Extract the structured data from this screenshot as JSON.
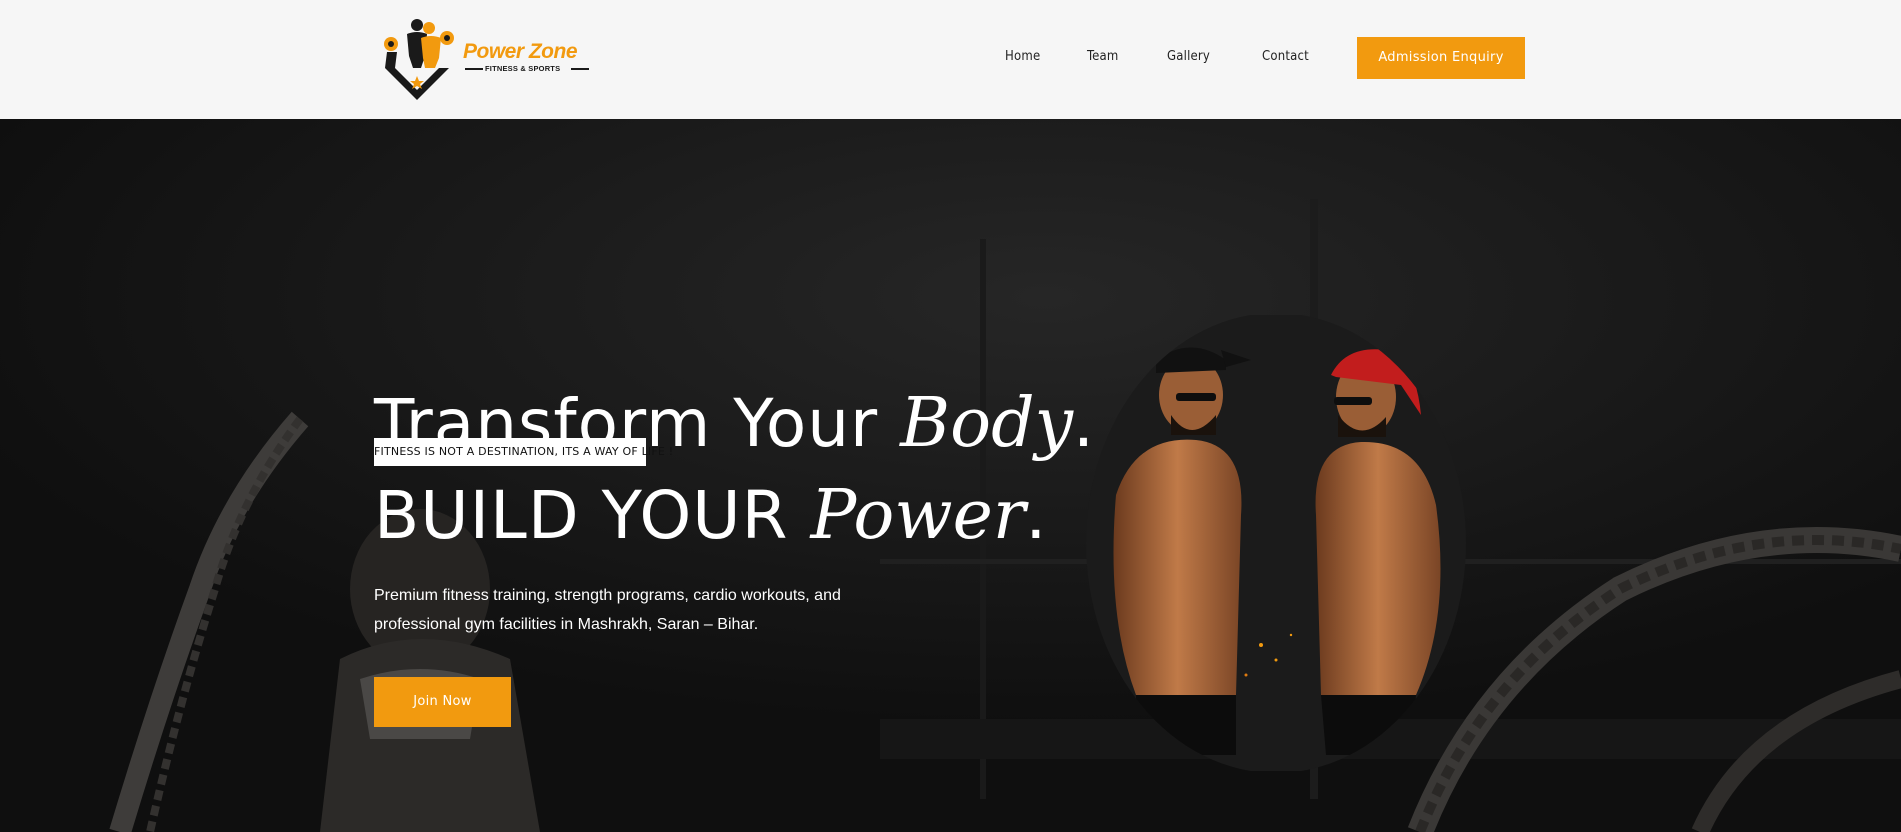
{
  "header": {
    "logo": {
      "name": "Power Zone",
      "tagline": "FITNESS & SPORTS"
    },
    "nav": [
      {
        "label": "Home"
      },
      {
        "label": "Team"
      },
      {
        "label": "Gallery"
      },
      {
        "label": "Contact"
      }
    ],
    "cta_label": "Admission Enquiry"
  },
  "hero": {
    "badge": "FITNESS IS NOT A DESTINATION, ITS A WAY OF LIFE !",
    "title_line1_plain": "Transform Your ",
    "title_line1_em": "Body",
    "title_line1_end": ".",
    "title_line2_plain": "BUILD YOUR ",
    "title_line2_em": "Power",
    "title_line2_end": ".",
    "description": "Premium fitness training, strength programs, cardio workouts, and professional gym facilities in Mashrakh, Saran – Bihar.",
    "cta_label": "Join Now"
  },
  "colors": {
    "accent": "#f29a0f",
    "header_bg": "#f6f6f6",
    "hero_bg": "#151515"
  },
  "icons": [
    "logo-emblem-icon"
  ]
}
